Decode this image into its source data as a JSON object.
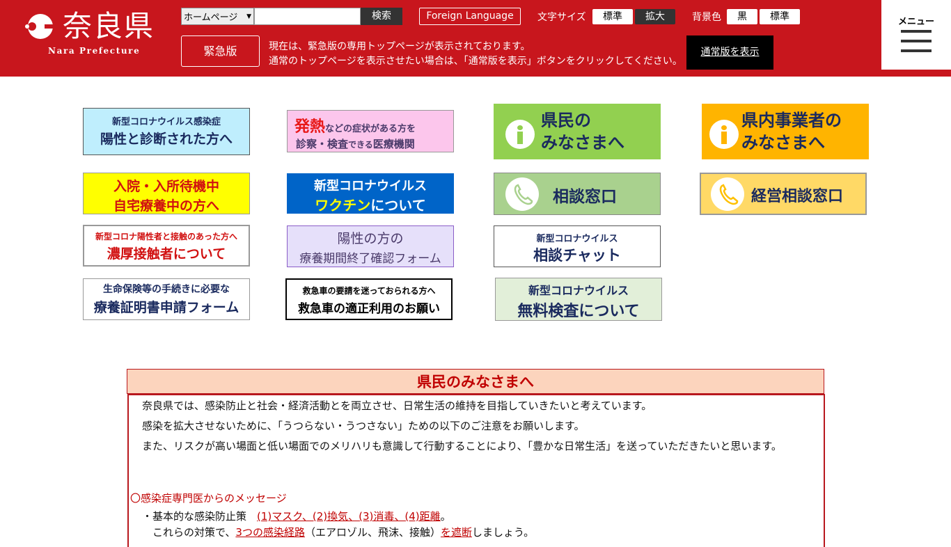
{
  "header": {
    "logo_title": "奈良県",
    "logo_subtitle": "Nara Prefecture",
    "search": {
      "selected_option": "ホームページ",
      "input_value": "",
      "button_label": "検索"
    },
    "foreign_language_label": "Foreign Language",
    "font_size": {
      "label": "文字サイズ",
      "standard": "標準",
      "large": "拡大"
    },
    "background_color": {
      "label": "背景色",
      "black": "黒",
      "standard": "標準"
    },
    "emergency_label": "緊急版",
    "notice_line1": "現在は、緊急版の専用トップページが表示されております。",
    "notice_line2": "通常のトップページを表示させたい場合は、「通常版を表示」ボタンをクリックしてください。",
    "normal_version_label": "通常版を表示",
    "menu_label": "メニュー"
  },
  "banners": {
    "positive": {
      "line1": "新型コロナウイルス感染症",
      "line2": "陽性と診断された方へ"
    },
    "fever": {
      "em": "発熱",
      "line1_rest": "などの症状がある方を",
      "line2a": "診察・検査",
      "line2b": "できる",
      "line2c": "医療機関"
    },
    "residents": {
      "line1": "県民の",
      "line2": "みなさまへ"
    },
    "business": {
      "line1": "県内事業者の",
      "line2": "みなさまへ"
    },
    "home_care": {
      "line1": "入院・入所待機中",
      "line2": "自宅療養中の方へ"
    },
    "vaccine": {
      "line1": "新型コロナウイルス",
      "line2a": "ワクチン",
      "line2b": "について"
    },
    "consult": {
      "label": "相談窓口"
    },
    "business_consult": {
      "label": "経営相談窓口"
    },
    "close_contact": {
      "line1": "新型コロナ陽性者と接触のあった方へ",
      "line2": "濃厚接触者について"
    },
    "recovery_form": {
      "line1": "陽性の方の",
      "line2": "療養期間終了確認フォーム"
    },
    "chat": {
      "line1": "新型コロナウイルス",
      "line2": "相談チャット"
    },
    "insurance": {
      "line1": "生命保険等の手続きに必要な",
      "line2": "療養証明書申請フォーム"
    },
    "ambulance": {
      "line1": "救急車の要請を迷っておられる方へ",
      "line2": "救急車の適正利用のお願い"
    },
    "free_test": {
      "line1": "新型コロナウイルス",
      "line2": "無料検査について"
    }
  },
  "section": {
    "title": "県民のみなさまへ",
    "para1": "　奈良県では、感染防止と社会・経済活動とを両立させ、日常生活の維持を目指していきたいと考えています。",
    "para2": "　感染を拡大させないために、「うつらない・うつさない」ための以下のご注意をお願いします。",
    "para3": "　また、リスクが高い場面と低い場面でのメリハリも意識して行動することにより、「豊かな日常生活」を送っていただきたいと思います。",
    "message_title": "〇感染症専門医からのメッセージ",
    "basic_prefix": "　・基本的な感染防止策　",
    "basic_links": "(1)マスク、(2)換気、(3)消毒、(4)距離",
    "basic_suffix": "。",
    "route_prefix": "　　これらの対策で、",
    "route_link": "3つの感染経路",
    "route_middle": "（エアロゾル、飛沫、接触）",
    "route_link2": "を遮断",
    "route_suffix": "しましょう。"
  },
  "colors": {
    "header_bg": "#c8161d",
    "accent_red": "#c00000",
    "section_head_bg": "#fcd4bd"
  }
}
